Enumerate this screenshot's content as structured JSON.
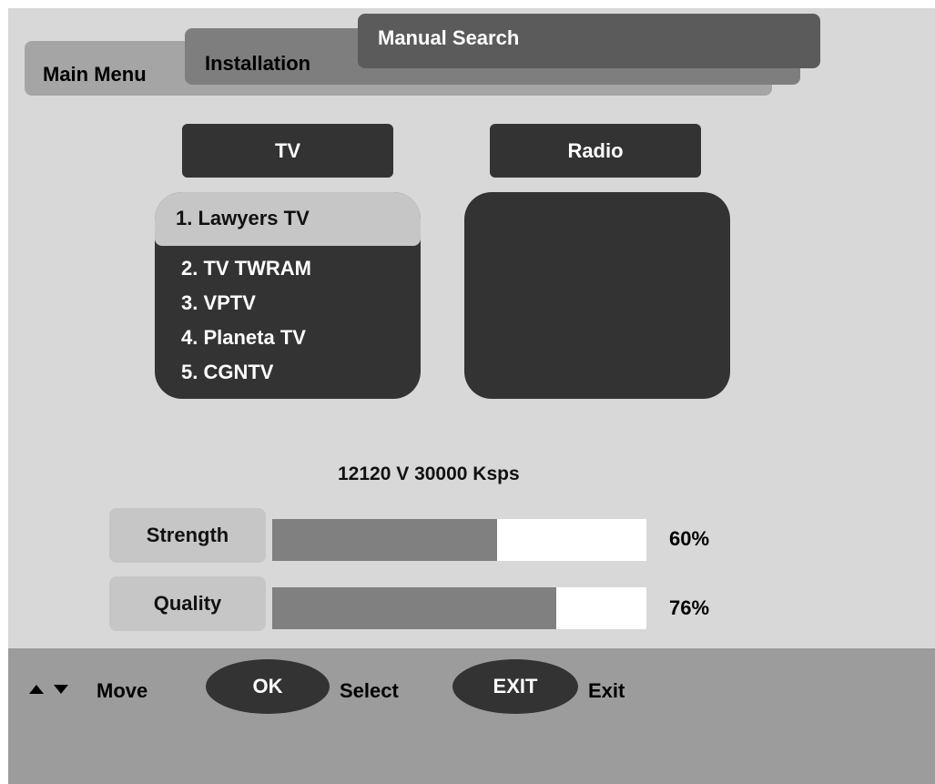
{
  "breadcrumb": {
    "main_menu": "Main Menu",
    "installation": "Installation",
    "manual_search": "Manual Search"
  },
  "categories": {
    "tv": "TV",
    "radio": "Radio"
  },
  "tv_channels": [
    "1. Lawyers TV",
    "2. TV TWRAM",
    "3. VPTV",
    "4. Planeta TV",
    "5. CGNTV"
  ],
  "radio_channels": [],
  "transponder": "12120 V 30000 Ksps",
  "meters": {
    "strength": {
      "label": "Strength",
      "value": 60,
      "display": "60%"
    },
    "quality": {
      "label": "Quality",
      "value": 76,
      "display": "76%"
    }
  },
  "footer": {
    "move_label": "Move",
    "ok_button": "OK",
    "select_label": "Select",
    "exit_button": "EXIT",
    "exit_label": "Exit"
  },
  "colors": {
    "background": "#d8d8d8",
    "panel": "#333333",
    "selected": "#c6c6c6",
    "footer": "#9c9c9c",
    "meter_fill": "#808080"
  }
}
